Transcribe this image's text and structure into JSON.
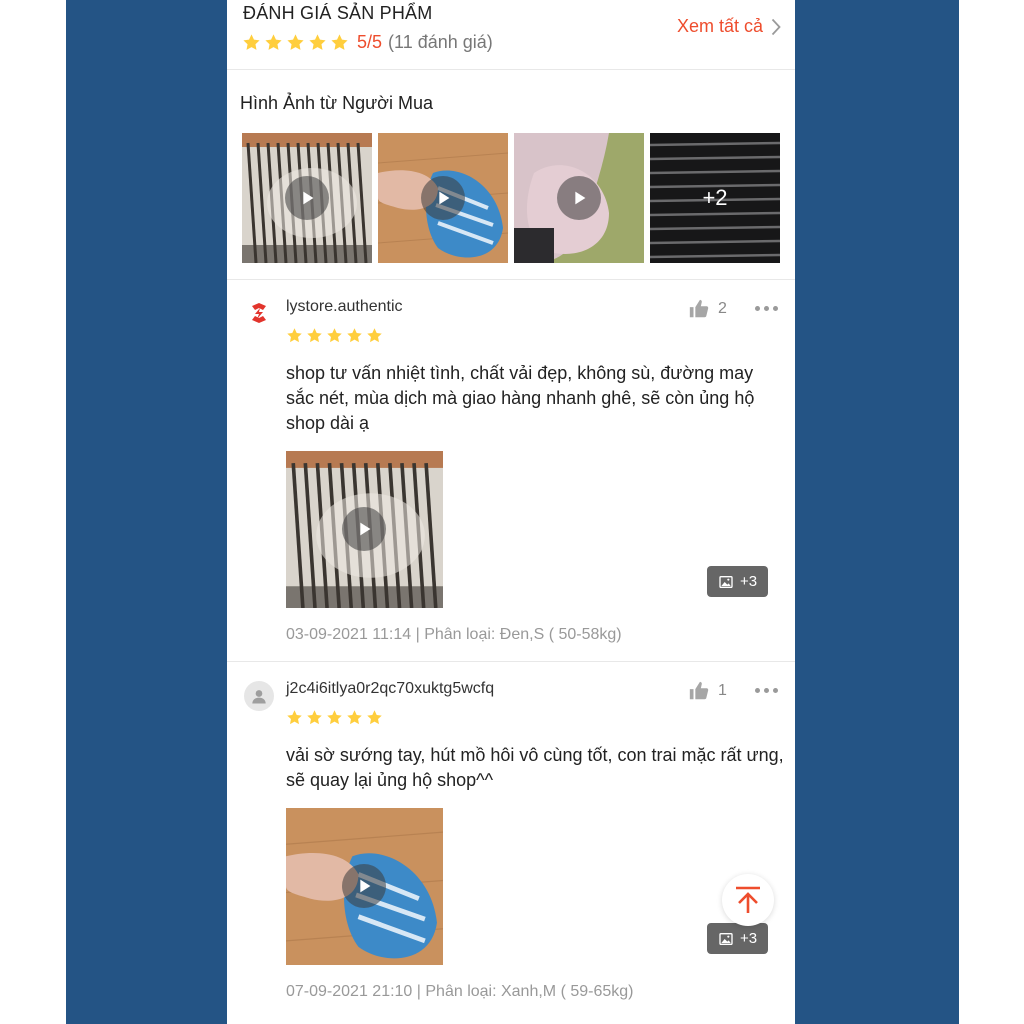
{
  "header": {
    "title": "ĐÁNH GIÁ SẢN PHẨM",
    "rating_value": "5/5",
    "rating_count": "(11 đánh giá)",
    "see_all": "Xem tất cả",
    "stars": 5
  },
  "gallery": {
    "title": "Hình Ảnh từ Người Mua",
    "more_count": "+2"
  },
  "reviews": [
    {
      "username": "lystore.authentic",
      "stars": 5,
      "likes": "2",
      "text": "shop tư vấn nhiệt tình, chất vải đẹp, không sù, đường may sắc nét, mùa dịch mà giao hàng nhanh ghê, sẽ còn ủng hộ shop dài ạ",
      "extra_media": "+3",
      "meta": "03-09-2021 11:14 | Phân loại: Đen,S ( 50-58kg)"
    },
    {
      "username": "j2c4i6itlya0r2qc70xuktg5wcfq",
      "stars": 5,
      "likes": "1",
      "text": "vải sờ sướng tay, hút mồ hôi vô cùng tốt, con trai mặc rất ưng, sẽ quay lại ủng hộ shop^^",
      "extra_media": "+3",
      "meta": "07-09-2021 21:10 | Phân loại: Xanh,M ( 59-65kg)"
    }
  ],
  "colors": {
    "accent": "#ee4d2d",
    "star": "#ffce3d",
    "side_background": "#245485"
  },
  "icons": [
    "star-icon",
    "chevron-right-icon",
    "play-icon",
    "thumbs-up-icon",
    "more-dots-icon",
    "image-icon",
    "scroll-to-top-icon",
    "user-avatar-icon"
  ]
}
